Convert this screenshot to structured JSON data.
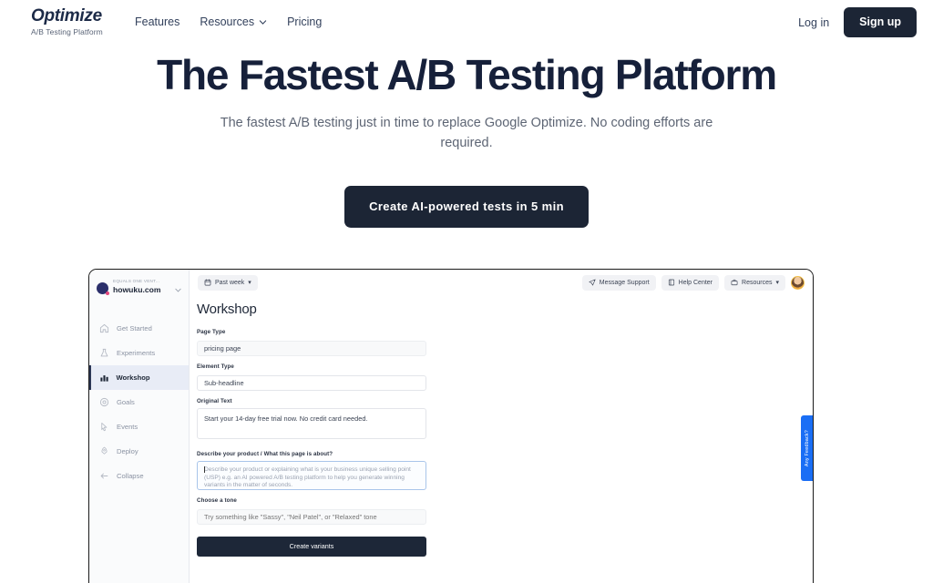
{
  "nav": {
    "brand_name": "Optimize",
    "brand_tagline": "A/B Testing Platform",
    "links": [
      {
        "label": "Features",
        "has_caret": false
      },
      {
        "label": "Resources",
        "has_caret": true
      },
      {
        "label": "Pricing",
        "has_caret": false
      }
    ],
    "login_label": "Log in",
    "signup_label": "Sign up"
  },
  "hero": {
    "title": "The Fastest A/B Testing Platform",
    "subtitle": "The fastest A/B testing just in time to replace Google Optimize. No coding efforts are required.",
    "cta_label": "Create AI-powered tests in 5 min"
  },
  "app": {
    "workspace": {
      "org_name": "EQUALS ONE VENT...",
      "domain": "howuku.com"
    },
    "sidebar_items": [
      {
        "label": "Get Started",
        "icon": "home-icon",
        "active": false
      },
      {
        "label": "Experiments",
        "icon": "flask-icon",
        "active": false
      },
      {
        "label": "Workshop",
        "icon": "bar-chart-icon",
        "active": true
      },
      {
        "label": "Goals",
        "icon": "target-icon",
        "active": false
      },
      {
        "label": "Events",
        "icon": "cursor-click-icon",
        "active": false
      },
      {
        "label": "Deploy",
        "icon": "rocket-icon",
        "active": false
      },
      {
        "label": "Collapse",
        "icon": "arrow-left-icon",
        "active": false
      }
    ],
    "topbar": {
      "date_range": "Past week",
      "message_support": "Message Support",
      "help_center": "Help Center",
      "resources": "Resources"
    },
    "panel": {
      "title": "Workshop",
      "fields": [
        {
          "label": "Page Type",
          "value": "pricing page",
          "type": "input",
          "shaded": true
        },
        {
          "label": "Element Type",
          "value": "Sub-headline",
          "type": "input",
          "shaded": false
        },
        {
          "label": "Original Text",
          "value": "Start your 14-day free trial now. No credit card needed.",
          "type": "textarea",
          "shaded": false
        }
      ],
      "describe_label": "Describe your product / What this page is about?",
      "describe_placeholder": "Describe your product or explaining what is your business unique selling point (USP) e.g. an AI powered A/B testing platform to help you generate winning variants in the matter of seconds.",
      "tone_label": "Choose a tone",
      "tone_placeholder": "Try something like \"Sassy\", \"Neil Patel\", or \"Relaxed\" tone",
      "submit_label": "Create variants"
    },
    "feedback_tab_label": "Any Feedback?"
  },
  "colors": {
    "brand_navy": "#1c2535",
    "accent_blue": "#1a6ef5",
    "active_nav_bg": "#e8ecf6"
  }
}
